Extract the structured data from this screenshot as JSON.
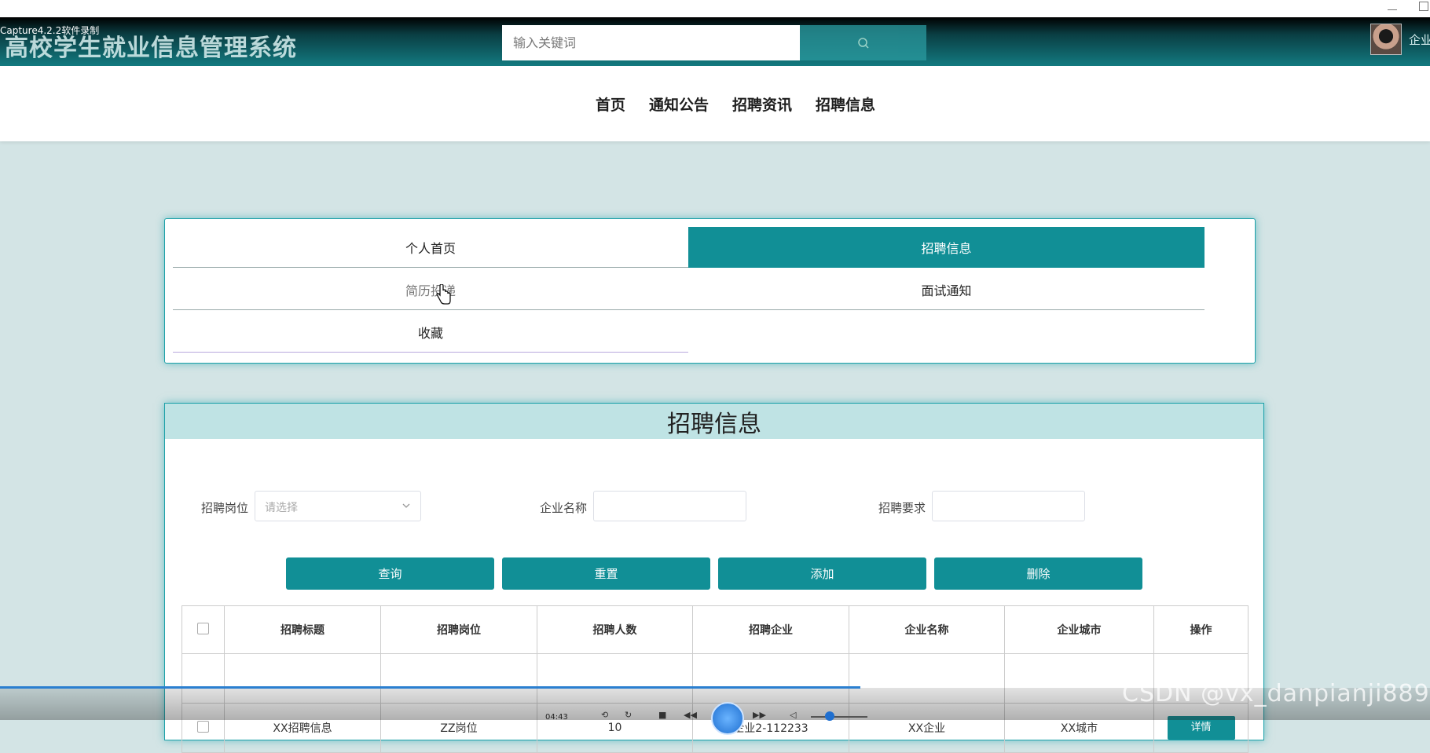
{
  "recorder": {
    "watermark": "Capture4.2.2软件录制"
  },
  "header": {
    "site_title": "高校学生就业信息管理系统",
    "search_placeholder": "输入关键词",
    "user_label": "企业"
  },
  "nav": {
    "items": [
      {
        "label": "首页"
      },
      {
        "label": "通知公告"
      },
      {
        "label": "招聘资讯"
      },
      {
        "label": "招聘信息"
      }
    ]
  },
  "user_panel": {
    "items": [
      {
        "label": "个人首页",
        "active": false
      },
      {
        "label": "招聘信息",
        "active": true
      },
      {
        "label": "简历投递",
        "active": false
      },
      {
        "label": "面试通知",
        "active": false
      },
      {
        "label": "收藏",
        "active": false
      }
    ]
  },
  "card": {
    "title": "招聘信息",
    "filters": {
      "position_label": "招聘岗位",
      "position_placeholder": "请选择",
      "company_label": "企业名称",
      "company_value": "",
      "requirement_label": "招聘要求",
      "requirement_value": ""
    },
    "buttons": {
      "query": "查询",
      "reset": "重置",
      "add": "添加",
      "delete": "删除"
    },
    "table": {
      "headers": [
        "招聘标题",
        "招聘岗位",
        "招聘人数",
        "招聘企业",
        "企业名称",
        "企业城市",
        "操作"
      ],
      "rows": [
        {
          "cells": [
            "",
            "",
            "",
            "",
            "",
            ""
          ],
          "action": ""
        },
        {
          "cells": [
            "XX招聘信息",
            "ZZ岗位",
            "10",
            "企业2-112233",
            "XX企业",
            "XX城市"
          ],
          "action": "详情"
        }
      ]
    }
  },
  "player": {
    "time": "04:43"
  },
  "watermark": "CSDN @vx_danpianji889"
}
